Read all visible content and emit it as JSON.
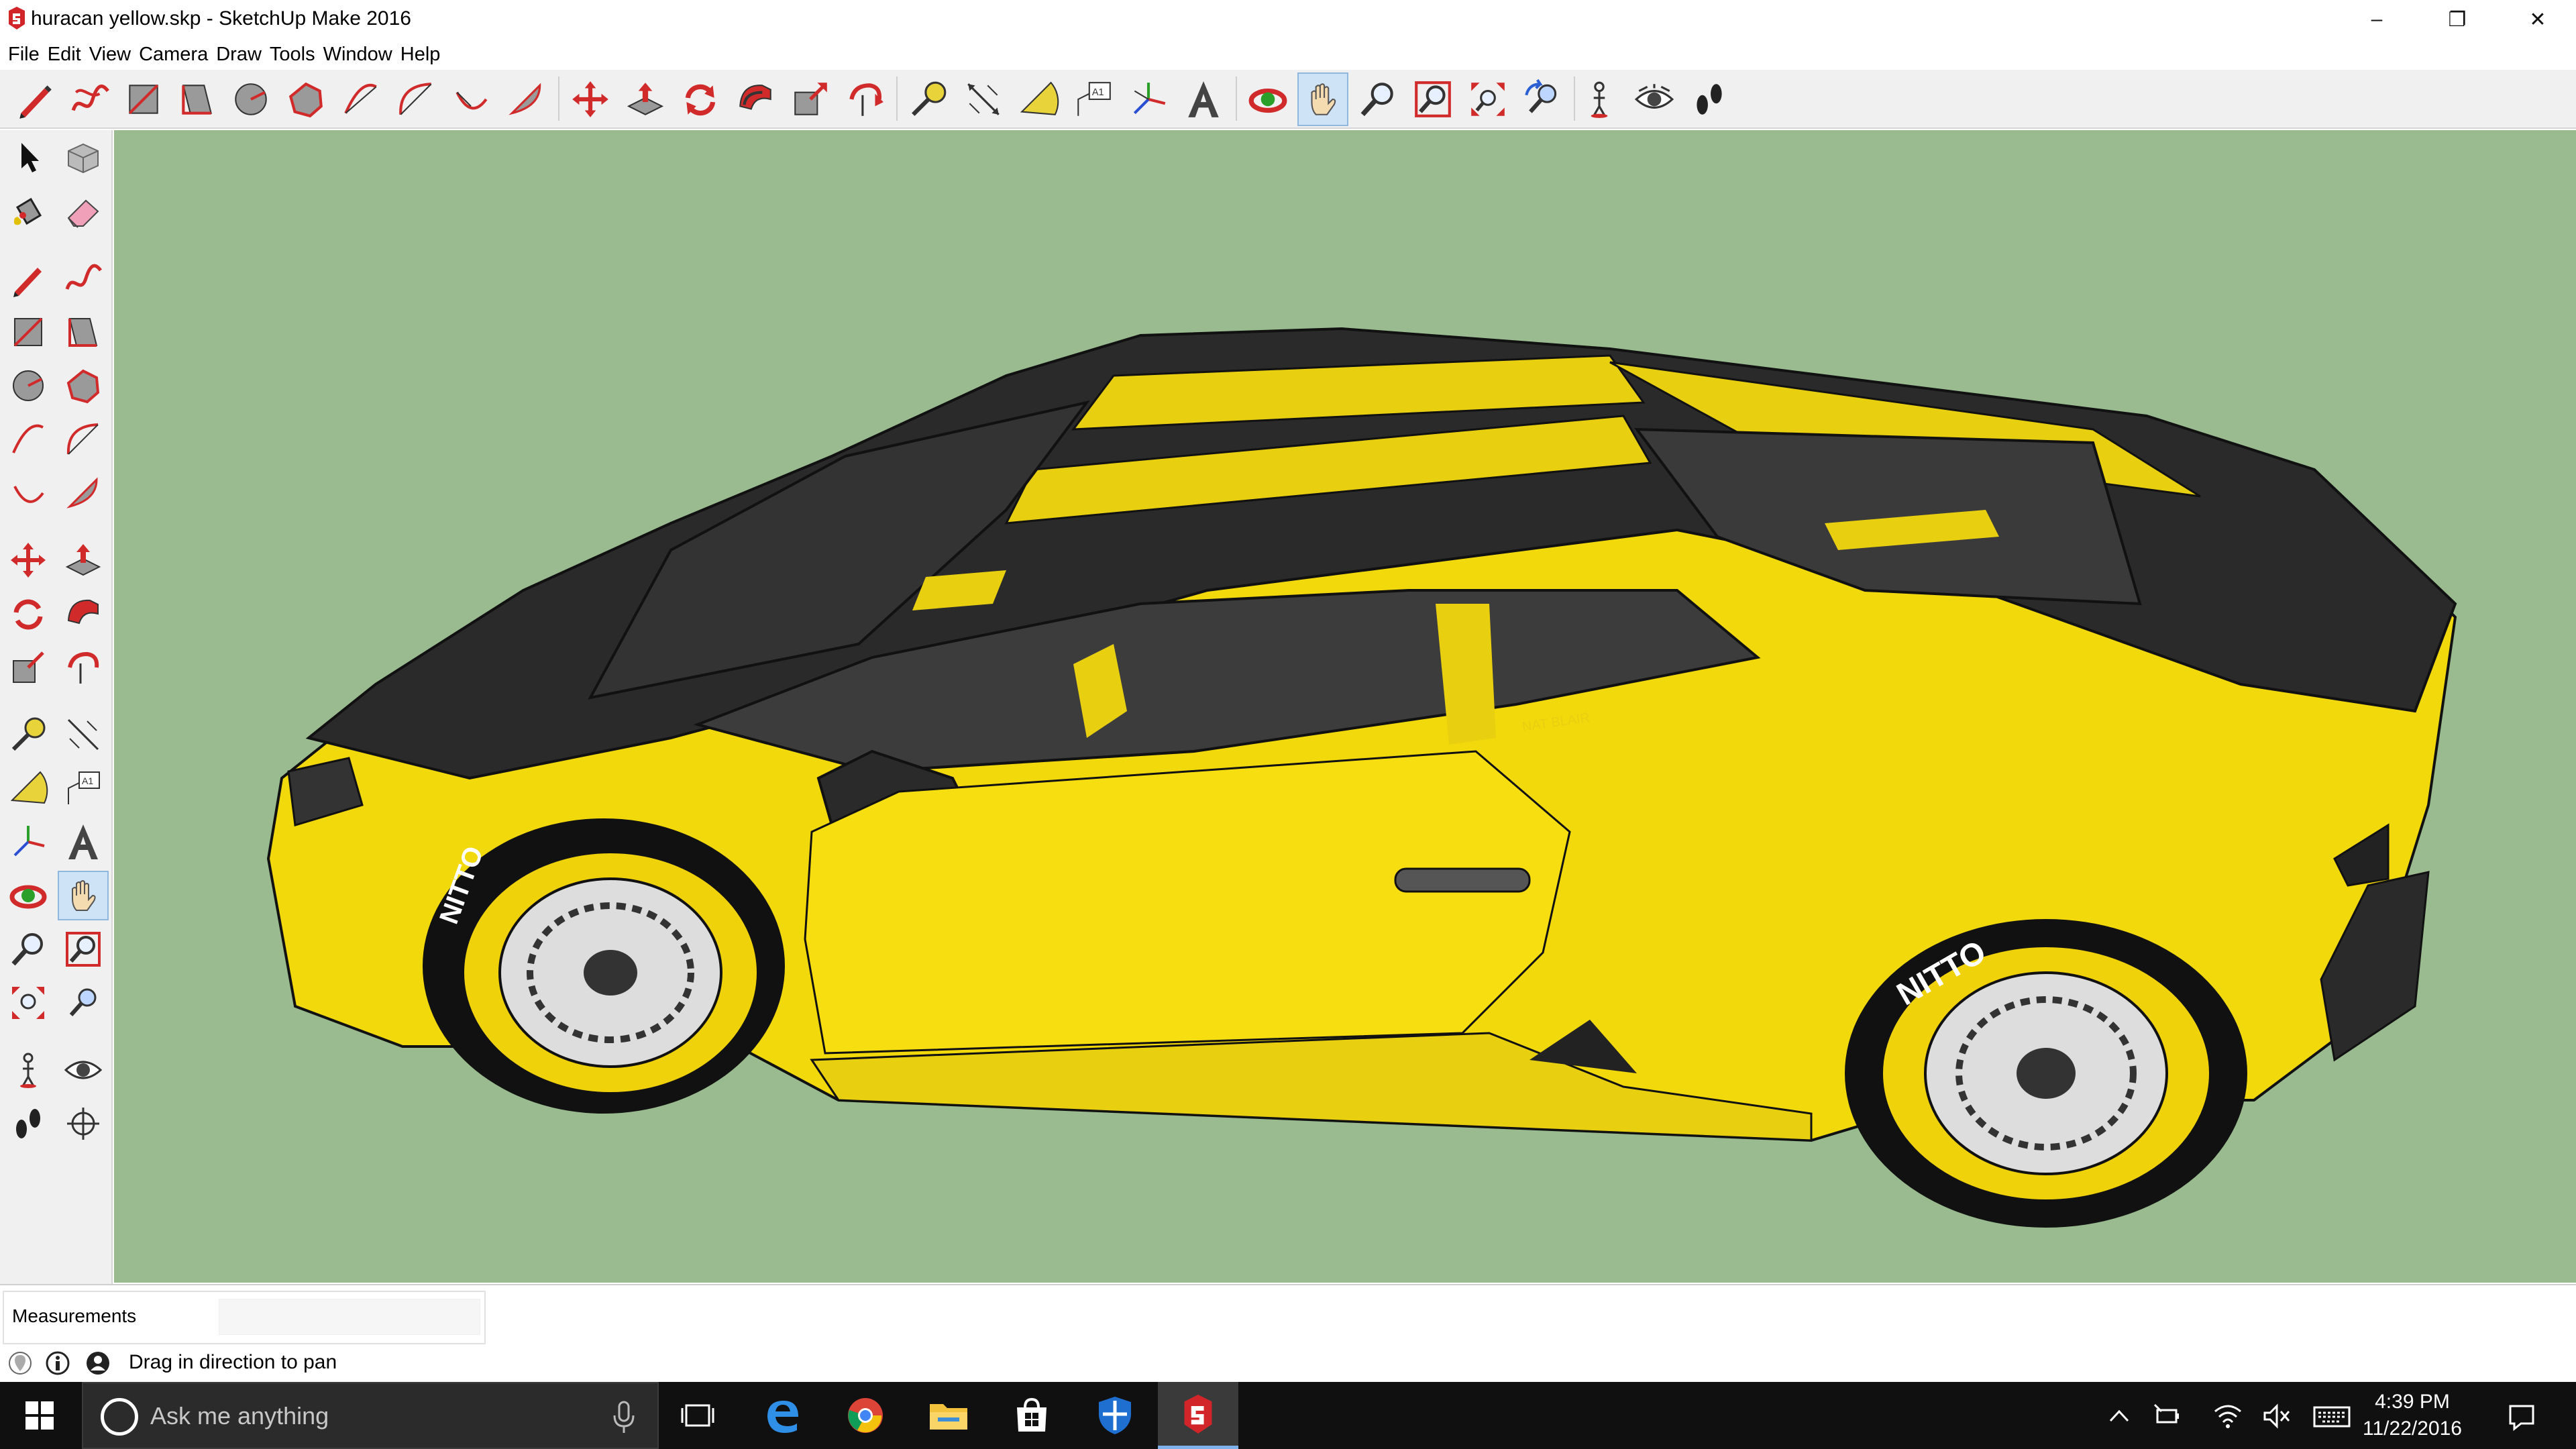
{
  "window": {
    "title": "huracan yellow.skp - SketchUp Make 2016",
    "minimize": "–",
    "maximize": "❐",
    "close": "✕"
  },
  "menu": [
    "File",
    "Edit",
    "View",
    "Camera",
    "Draw",
    "Tools",
    "Window",
    "Help"
  ],
  "top_toolbar": [
    "line-tool",
    "freehand-tool",
    "rectangle-tool",
    "rotated-rectangle-tool",
    "circle-tool",
    "polygon-tool",
    "arc-tool",
    "two-point-arc-tool",
    "three-point-arc-tool",
    "pie-tool",
    "move-tool",
    "push-pull-tool",
    "rotate-tool",
    "follow-me-tool",
    "scale-tool",
    "offset-tool",
    "tape-measure-tool",
    "dimension-tool",
    "protractor-tool",
    "text-tool",
    "axes-tool",
    "3d-text-tool",
    "orbit-tool",
    "pan-tool",
    "zoom-tool",
    "zoom-window-tool",
    "zoom-extents-tool",
    "previous-view-tool",
    "position-camera-tool",
    "look-around-tool",
    "walk-tool"
  ],
  "active_tool": "pan-tool",
  "viewport": {
    "background": "#99bb8f",
    "signature_text": "NAT BLAIR",
    "tire_text": "NITTO"
  },
  "measurements": {
    "label": "Measurements",
    "value": ""
  },
  "status": {
    "text": "Drag in direction to pan"
  },
  "taskbar": {
    "search_placeholder": "Ask me anything",
    "apps": [
      "task-view",
      "edge",
      "chrome",
      "file-explorer",
      "store",
      "windows-defender",
      "sketchup"
    ],
    "running_app": "sketchup",
    "clock_time": "4:39 PM",
    "clock_date": "11/22/2016"
  }
}
